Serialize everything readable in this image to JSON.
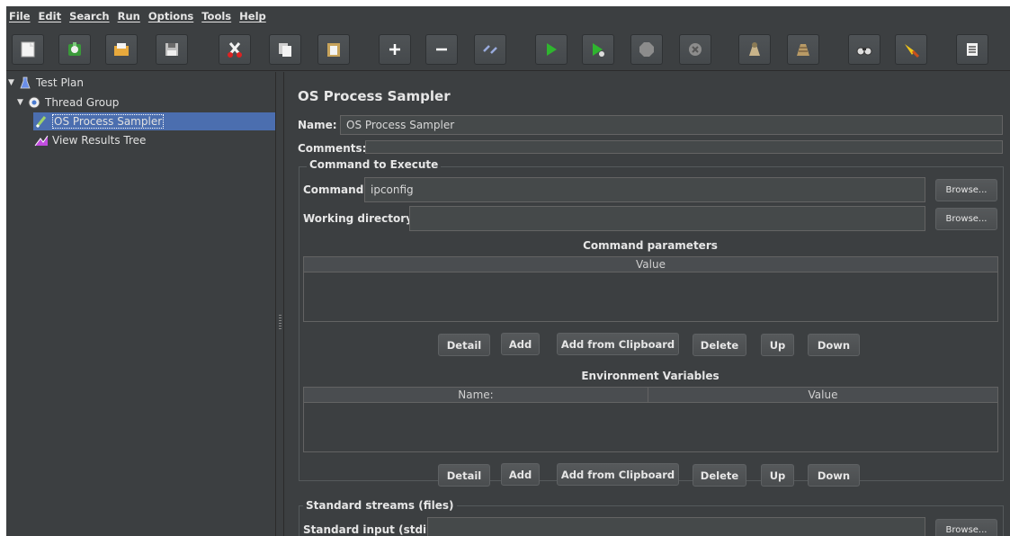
{
  "menubar": {
    "items": [
      "File",
      "Edit",
      "Search",
      "Run",
      "Options",
      "Tools",
      "Help"
    ]
  },
  "toolbar": {
    "buttons": [
      {
        "name": "new-icon"
      },
      {
        "name": "templates-icon"
      },
      {
        "name": "open-icon"
      },
      {
        "name": "save-icon"
      },
      {
        "name": "cut-icon"
      },
      {
        "name": "copy-icon"
      },
      {
        "name": "paste-icon"
      },
      {
        "name": "expand-icon"
      },
      {
        "name": "collapse-icon"
      },
      {
        "name": "toggle-icon"
      },
      {
        "name": "start-icon"
      },
      {
        "name": "start-no-timers-icon"
      },
      {
        "name": "stop-icon"
      },
      {
        "name": "shutdown-icon"
      },
      {
        "name": "clear-icon"
      },
      {
        "name": "clear-all-icon"
      },
      {
        "name": "search-icon"
      },
      {
        "name": "reset-search-icon"
      },
      {
        "name": "function-helper-icon"
      }
    ]
  },
  "tree": {
    "items": [
      {
        "label": "Test Plan",
        "icon": "flask-icon"
      },
      {
        "label": "Thread Group",
        "icon": "gear-icon"
      },
      {
        "label": "OS Process Sampler",
        "icon": "pipette-icon",
        "selected": true
      },
      {
        "label": "View Results Tree",
        "icon": "graph-icon"
      }
    ]
  },
  "main": {
    "title": "OS Process Sampler",
    "name_label": "Name:",
    "name_value": "OS Process Sampler",
    "comments_label": "Comments:",
    "comments_value": "",
    "command_section": "Command to Execute",
    "command_label": "Command:",
    "command_value": "ipconfig",
    "working_dir_label": "Working directory:",
    "working_dir_value": "",
    "browse_label": "Browse...",
    "params_title": "Command parameters",
    "params_columns": [
      "Value"
    ],
    "env_title": "Environment Variables",
    "env_columns": [
      "Name:",
      "Value"
    ],
    "table_buttons": [
      "Detail",
      "Add",
      "Add from Clipboard",
      "Delete",
      "Up",
      "Down"
    ],
    "streams_section": "Standard streams (files)",
    "stdin_label": "Standard input (stdin):",
    "stdin_value": ""
  },
  "colors": {
    "background": "#3c3f41",
    "selection": "#4b6eaf",
    "field": "#45494a",
    "start_green": "#2fb52f"
  }
}
